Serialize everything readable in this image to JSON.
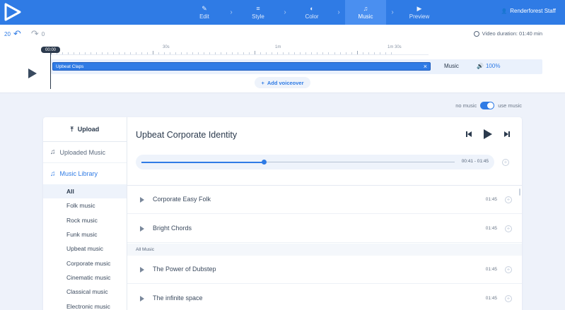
{
  "app": {
    "logo_icon": "play-logo-icon",
    "brand_color": "#2f7be5"
  },
  "steps": [
    {
      "label": "Edit",
      "icon": "pencil-icon",
      "glyph": "✎"
    },
    {
      "label": "Style",
      "icon": "stack-icon",
      "glyph": "≡"
    },
    {
      "label": "Color",
      "icon": "palette-icon",
      "glyph": "◐"
    },
    {
      "label": "Music",
      "icon": "music-icon",
      "glyph": "♫"
    },
    {
      "label": "Preview",
      "icon": "play-icon",
      "glyph": "▶"
    }
  ],
  "active_step": "Music",
  "user": {
    "name": "Renderforest Staff",
    "icon": "user-icon"
  },
  "timeline": {
    "undo_count": "20",
    "redo_count": "0",
    "duration_label": "Video duration: 01:40 min",
    "playhead_time": "00:00",
    "ruler_labels": [
      "30s",
      "1m",
      "1m 30s"
    ],
    "clip_name": "Upbeat Claps",
    "track_label": "Music",
    "volume": "100%",
    "add_voiceover": "Add voiceover"
  },
  "music_toggle": {
    "off_label": "no music",
    "on_label": "use music",
    "enabled": true
  },
  "sidebar": {
    "upload": "Upload",
    "uploaded_music": "Uploaded Music",
    "music_library": "Music Library",
    "categories": [
      "All",
      "Folk music",
      "Rock music",
      "Funk music",
      "Upbeat music",
      "Corporate music",
      "Cinematic music",
      "Classical music",
      "Electronic music"
    ],
    "active_category": "All"
  },
  "player": {
    "title": "Upbeat Corporate Identity",
    "time": "00:41 - 01:45",
    "progress": 0.39
  },
  "tracks_top": [
    {
      "name": "Corporate Easy Folk",
      "duration": "01:45"
    },
    {
      "name": "Bright Chords",
      "duration": "01:45"
    }
  ],
  "section_label": "All Music",
  "tracks_all": [
    {
      "name": "The Power of Dubstep",
      "duration": "01:45"
    },
    {
      "name": "The infinite space",
      "duration": "01:45"
    }
  ]
}
